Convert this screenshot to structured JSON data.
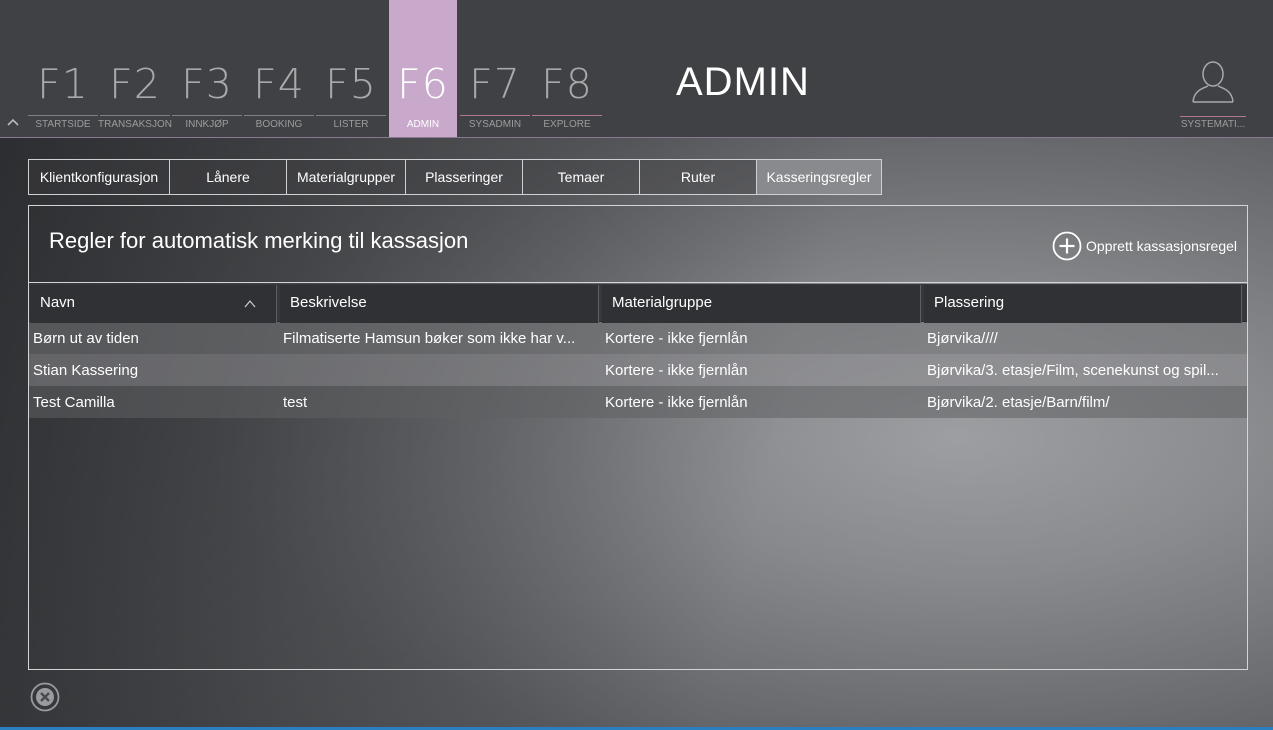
{
  "header": {
    "module_title": "ADMIN",
    "fkeys": [
      {
        "num": "F1",
        "label": "STARTSIDE",
        "active": false
      },
      {
        "num": "F2",
        "label": "TRANSAKSJON",
        "active": false
      },
      {
        "num": "F3",
        "label": "INNKJØP",
        "active": false
      },
      {
        "num": "F4",
        "label": "BOOKING",
        "active": false
      },
      {
        "num": "F5",
        "label": "LISTER",
        "active": false
      },
      {
        "num": "F6",
        "label": "ADMIN",
        "active": true
      },
      {
        "num": "F7",
        "label": "SYSADMIN",
        "active": false
      },
      {
        "num": "F8",
        "label": "EXPLORE",
        "active": false
      }
    ],
    "user_label": "SYSTEMATI..."
  },
  "tabs": [
    {
      "label": "Klientkonfigurasjon",
      "active": false
    },
    {
      "label": "Lånere",
      "active": false
    },
    {
      "label": "Materialgrupper",
      "active": false
    },
    {
      "label": "Plasseringer",
      "active": false
    },
    {
      "label": "Temaer",
      "active": false
    },
    {
      "label": "Ruter",
      "active": false
    },
    {
      "label": "Kasseringsregler",
      "active": true
    }
  ],
  "panel": {
    "title": "Regler for automatisk merking til kassasjon",
    "create_label": "Opprett kassasjonsregel"
  },
  "table": {
    "columns": [
      "Navn",
      "Beskrivelse",
      "Materialgruppe",
      "Plassering"
    ],
    "sort_indicator": "^",
    "rows": [
      [
        "Børn ut av tiden",
        "Filmatiserte Hamsun bøker som ikke har v...",
        "Kortere - ikke fjernlån",
        "Bjørvika////"
      ],
      [
        "Stian Kassering",
        "",
        "Kortere - ikke fjernlån",
        "Bjørvika/3. etasje/Film, scenekunst og spil..."
      ],
      [
        "Test Camilla",
        "test",
        "Kortere - ikke fjernlån",
        "Bjørvika/2. etasje/Barn/film/"
      ]
    ]
  },
  "colors": {
    "accent_active_fkey": "#c8a8cb",
    "accent_underline": "#b07a92",
    "topbar": "#404144",
    "status_strip": "#2a7fc1"
  },
  "icons": {
    "collapse": "chevron-up-icon",
    "user": "user-silhouette-icon",
    "create": "plus-circle-icon",
    "close": "close-circle-icon"
  }
}
